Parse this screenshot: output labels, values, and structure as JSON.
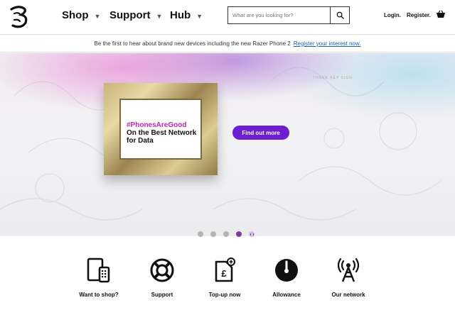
{
  "header": {
    "nav": [
      {
        "label": "Shop"
      },
      {
        "label": "Support"
      },
      {
        "label": "Hub"
      }
    ],
    "search_placeholder": "What are you looking for?",
    "login_label": "Login.",
    "register_label": "Register."
  },
  "promo": {
    "text": "Be the first to hear about brand new devices including the new Razer Phone 2",
    "link": "Register your interest now."
  },
  "hero": {
    "hashtag": "#PhonesAreGood",
    "tagline": "On the Best Network for Data",
    "cta": "Find out more",
    "watermark": "THREE KEY SIGN"
  },
  "tiles": [
    {
      "label": "Want to shop?",
      "icon": "devices-icon"
    },
    {
      "label": "Support",
      "icon": "lifebuoy-icon"
    },
    {
      "label": "Top-up now",
      "icon": "sim-topup-icon"
    },
    {
      "label": "Allowance",
      "icon": "gauge-icon"
    },
    {
      "label": "Our network",
      "icon": "signal-mast-icon"
    }
  ],
  "colors": {
    "accent": "#6b1fd1",
    "hashtag": "#c026b0",
    "link": "#1a5fb4",
    "dot_active": "#7b3fa0"
  }
}
